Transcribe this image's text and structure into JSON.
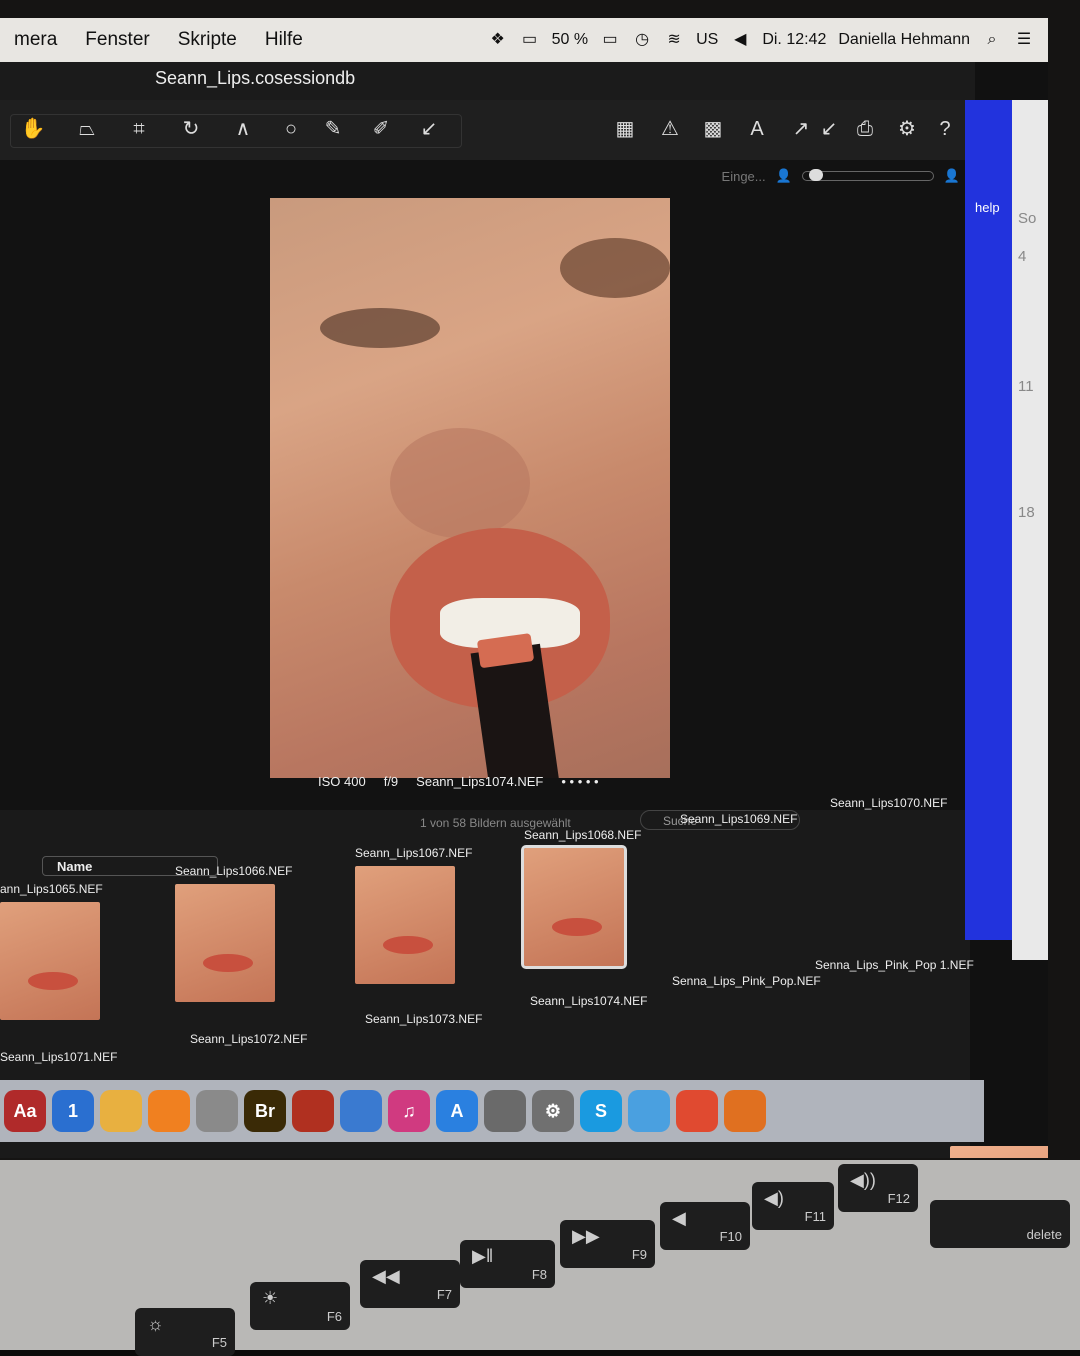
{
  "menubar": {
    "items": [
      "mera",
      "Fenster",
      "Skripte",
      "Hilfe"
    ],
    "battery": "50 %",
    "input_source": "US",
    "clock": "Di. 12:42",
    "user": "Daniella Hehmann"
  },
  "window": {
    "title": "Seann_Lips.cosessiondb"
  },
  "viewer": {
    "eingabe_label": "Einge...",
    "iso": "ISO 400",
    "aperture": "f/9",
    "filename": "Seann_Lips1074.NEF"
  },
  "browser": {
    "selection_info": "1 von 58 Bildern ausgewählt",
    "search_placeholder": "Suche",
    "sort_label": "Name",
    "row1": [
      {
        "name": "ann_Lips1065.NEF"
      },
      {
        "name": "Seann_Lips1066.NEF"
      },
      {
        "name": "Seann_Lips1067.NEF"
      },
      {
        "name": "Seann_Lips1068.NEF"
      },
      {
        "name": "Seann_Lips1069.NEF"
      },
      {
        "name": "Seann_Lips1070.NEF"
      }
    ],
    "row2": [
      {
        "name": "Seann_Lips1071.NEF"
      },
      {
        "name": "Seann_Lips1072.NEF"
      },
      {
        "name": "Seann_Lips1073.NEF"
      },
      {
        "name": "Seann_Lips1074.NEF"
      },
      {
        "name": "Senna_Lips_Pink_Pop.NEF"
      },
      {
        "name": "Senna_Lips_Pink_Pop 1.NEF"
      }
    ]
  },
  "side": {
    "help_label": "help",
    "numbers": [
      "So",
      "4",
      "11",
      "18"
    ]
  },
  "dock": {
    "apps": [
      {
        "icon": "dictionary-icon",
        "label": "Aa",
        "color": "#b02a2a"
      },
      {
        "icon": "1password-icon",
        "label": "1",
        "color": "#2a6fd0"
      },
      {
        "icon": "photos-icon",
        "label": "",
        "color": "#e8b040"
      },
      {
        "icon": "ibooks-icon",
        "label": "",
        "color": "#f08020"
      },
      {
        "icon": "preview-icon",
        "label": "",
        "color": "#8a8a8a"
      },
      {
        "icon": "bridge-icon",
        "label": "Br",
        "color": "#3a2a06"
      },
      {
        "icon": "photo-booth-icon",
        "label": "",
        "color": "#b03020"
      },
      {
        "icon": "dvd-icon",
        "label": "",
        "color": "#3a7ad0"
      },
      {
        "icon": "itunes-icon",
        "label": "♫",
        "color": "#d03a80"
      },
      {
        "icon": "app-store-icon",
        "label": "A",
        "color": "#2a80e0"
      },
      {
        "icon": "mail-icon",
        "label": "",
        "color": "#6a6a6a"
      },
      {
        "icon": "system-preferences-icon",
        "label": "⚙",
        "color": "#707070"
      },
      {
        "icon": "skype-icon",
        "label": "S",
        "color": "#1a9ae0"
      },
      {
        "icon": "finder-icon",
        "label": "",
        "color": "#4aa0e0"
      },
      {
        "icon": "chrome-icon",
        "label": "",
        "color": "#e04a30"
      },
      {
        "icon": "firefox-icon",
        "label": "",
        "color": "#e07020"
      }
    ]
  },
  "keyboard": {
    "keys": [
      {
        "label": "F5"
      },
      {
        "label": "F6"
      },
      {
        "label": "F7"
      },
      {
        "label": "F8"
      },
      {
        "label": "F9"
      },
      {
        "label": "F10"
      },
      {
        "label": "F11"
      },
      {
        "label": "F12"
      },
      {
        "label": "delete"
      }
    ]
  }
}
